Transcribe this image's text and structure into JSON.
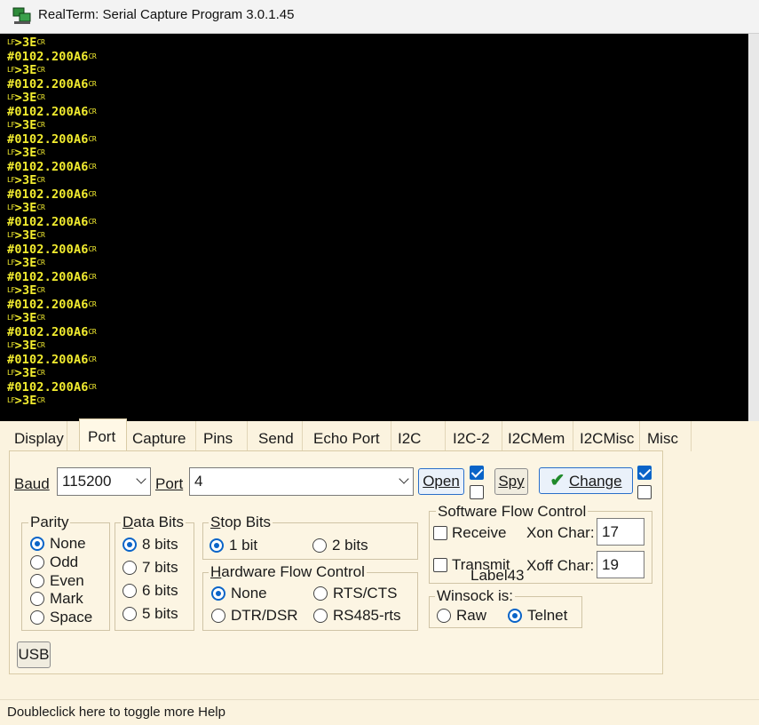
{
  "window": {
    "title": "RealTerm: Serial Capture Program 3.0.1.45",
    "icon": "realterm-app-icon"
  },
  "terminal": {
    "lines": [
      {
        "ctl_prefix": "LF",
        "text": ">3E",
        "ctl_suffix": "CR"
      },
      {
        "ctl_prefix": "",
        "text": "#0102.200A6",
        "ctl_suffix": "CR"
      },
      {
        "ctl_prefix": "LF",
        "text": ">3E",
        "ctl_suffix": "CR"
      },
      {
        "ctl_prefix": "",
        "text": "#0102.200A6",
        "ctl_suffix": "CR"
      },
      {
        "ctl_prefix": "LF",
        "text": ">3E",
        "ctl_suffix": "CR"
      },
      {
        "ctl_prefix": "",
        "text": "#0102.200A6",
        "ctl_suffix": "CR"
      },
      {
        "ctl_prefix": "LF",
        "text": ">3E",
        "ctl_suffix": "CR"
      },
      {
        "ctl_prefix": "",
        "text": "#0102.200A6",
        "ctl_suffix": "CR"
      },
      {
        "ctl_prefix": "LF",
        "text": ">3E",
        "ctl_suffix": "CR"
      },
      {
        "ctl_prefix": "",
        "text": "#0102.200A6",
        "ctl_suffix": "CR"
      },
      {
        "ctl_prefix": "LF",
        "text": ">3E",
        "ctl_suffix": "CR"
      },
      {
        "ctl_prefix": "",
        "text": "#0102.200A6",
        "ctl_suffix": "CR"
      },
      {
        "ctl_prefix": "LF",
        "text": ">3E",
        "ctl_suffix": "CR"
      },
      {
        "ctl_prefix": "",
        "text": "#0102.200A6",
        "ctl_suffix": "CR"
      },
      {
        "ctl_prefix": "LF",
        "text": ">3E",
        "ctl_suffix": "CR"
      },
      {
        "ctl_prefix": "",
        "text": "#0102.200A6",
        "ctl_suffix": "CR"
      },
      {
        "ctl_prefix": "LF",
        "text": ">3E",
        "ctl_suffix": "CR"
      },
      {
        "ctl_prefix": "",
        "text": "#0102.200A6",
        "ctl_suffix": "CR"
      },
      {
        "ctl_prefix": "LF",
        "text": ">3E",
        "ctl_suffix": "CR"
      },
      {
        "ctl_prefix": "",
        "text": "#0102.200A6",
        "ctl_suffix": "CR"
      },
      {
        "ctl_prefix": "LF",
        "text": ">3E",
        "ctl_suffix": "CR"
      },
      {
        "ctl_prefix": "",
        "text": "#0102.200A6",
        "ctl_suffix": "CR"
      },
      {
        "ctl_prefix": "LF",
        "text": ">3E",
        "ctl_suffix": "CR"
      },
      {
        "ctl_prefix": "",
        "text": "#0102.200A6",
        "ctl_suffix": "CR"
      },
      {
        "ctl_prefix": "LF",
        "text": ">3E",
        "ctl_suffix": "CR"
      },
      {
        "ctl_prefix": "",
        "text": "#0102.200A6",
        "ctl_suffix": "CR"
      },
      {
        "ctl_prefix": "LF",
        "text": ">3E",
        "ctl_suffix": "CR"
      }
    ],
    "text_color": "#f2ec2f",
    "background": "#000000"
  },
  "tabs": [
    {
      "label": "Display"
    },
    {
      "label": "Port",
      "active": true
    },
    {
      "label": "Capture"
    },
    {
      "label": "Pins"
    },
    {
      "label": "Send"
    },
    {
      "label": "Echo Port"
    },
    {
      "label": "I2C"
    },
    {
      "label": "I2C-2"
    },
    {
      "label": "I2CMem"
    },
    {
      "label": "I2CMisc"
    },
    {
      "label": "Misc"
    }
  ],
  "port": {
    "baud_label": "Baud",
    "baud_value": "115200",
    "port_label": "Port",
    "port_value": "4",
    "open_label": "Open",
    "spy_label": "Spy",
    "change_label": "Change",
    "open_checkbox_checked": true,
    "change_checkbox_checked": true,
    "parity": {
      "title": "Parity",
      "options": [
        "None",
        "Odd",
        "Even",
        "Mark",
        "Space"
      ],
      "selected": "None"
    },
    "data_bits": {
      "title": "Data Bits",
      "options": [
        "8 bits",
        "7 bits",
        "6 bits",
        "5 bits"
      ],
      "selected": "8 bits"
    },
    "stop_bits": {
      "title": "Stop Bits",
      "options": [
        "1 bit",
        "2 bits"
      ],
      "selected": "1 bit"
    },
    "hardware_flow": {
      "title": "Hardware Flow Control",
      "options": [
        "None",
        "RTS/CTS",
        "DTR/DSR",
        "RS485-rts"
      ],
      "selected": "None"
    },
    "software_flow": {
      "title": "Software Flow Control",
      "receive_label": "Receive",
      "transmit_label": "Transmit",
      "xon_label": "Xon Char:",
      "xon_value": "17",
      "xoff_label": "Xoff Char:",
      "xoff_value": "19",
      "overlay_label": "Label43"
    },
    "winsock": {
      "title": "Winsock is:",
      "options": [
        "Raw",
        "Telnet"
      ],
      "selected": "Telnet"
    },
    "usb_label": "USB"
  },
  "status": {
    "text": "Doubleclick here to toggle more Help"
  }
}
